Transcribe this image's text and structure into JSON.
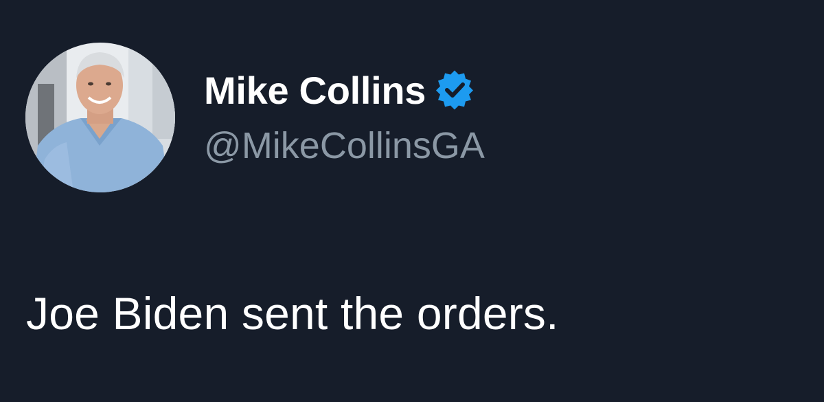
{
  "author": {
    "display_name": "Mike Collins",
    "handle": "@MikeCollinsGA",
    "verified": true,
    "avatar_icon": "profile-photo",
    "verified_icon": "verified-badge-icon"
  },
  "tweet": {
    "text": "Joe Biden sent the orders."
  },
  "colors": {
    "background": "#161d2a",
    "text_primary": "#ffffff",
    "text_secondary": "#8b98a5",
    "verified_blue": "#1d9bf0"
  }
}
